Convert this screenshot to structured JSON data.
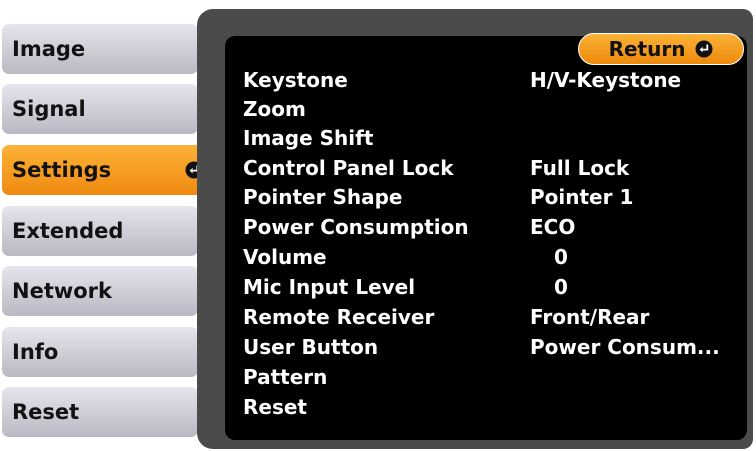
{
  "menu": {
    "items": [
      {
        "label": "Image"
      },
      {
        "label": "Signal"
      },
      {
        "label": "Settings"
      },
      {
        "label": "Extended"
      },
      {
        "label": "Network"
      },
      {
        "label": "Info"
      },
      {
        "label": "Reset"
      }
    ],
    "selected": "Settings"
  },
  "panel": {
    "return_label": "Return",
    "rows": [
      {
        "label": "Keystone",
        "value": "H/V-Keystone"
      },
      {
        "label": "Zoom",
        "value": ""
      },
      {
        "label": "Image Shift",
        "value": ""
      },
      {
        "label": "Control Panel Lock",
        "value": "Full Lock"
      },
      {
        "label": "Pointer Shape",
        "value": "Pointer 1"
      },
      {
        "label": "Power Consumption",
        "value": "ECO"
      },
      {
        "label": "Volume",
        "value": "0"
      },
      {
        "label": "Mic Input Level",
        "value": "0"
      },
      {
        "label": "Remote Receiver",
        "value": "Front/Rear"
      },
      {
        "label": "User Button",
        "value": "Power Consum..."
      },
      {
        "label": "Pattern",
        "value": ""
      },
      {
        "label": "Reset",
        "value": ""
      }
    ]
  },
  "colors": {
    "menu_item": "#d4d4dc",
    "selected": "#f6a024",
    "panel_frame": "#4c4b4b",
    "panel_bg": "#000000",
    "text_on_panel": "#ffffff"
  },
  "icons": {
    "enter": "enter-icon"
  }
}
